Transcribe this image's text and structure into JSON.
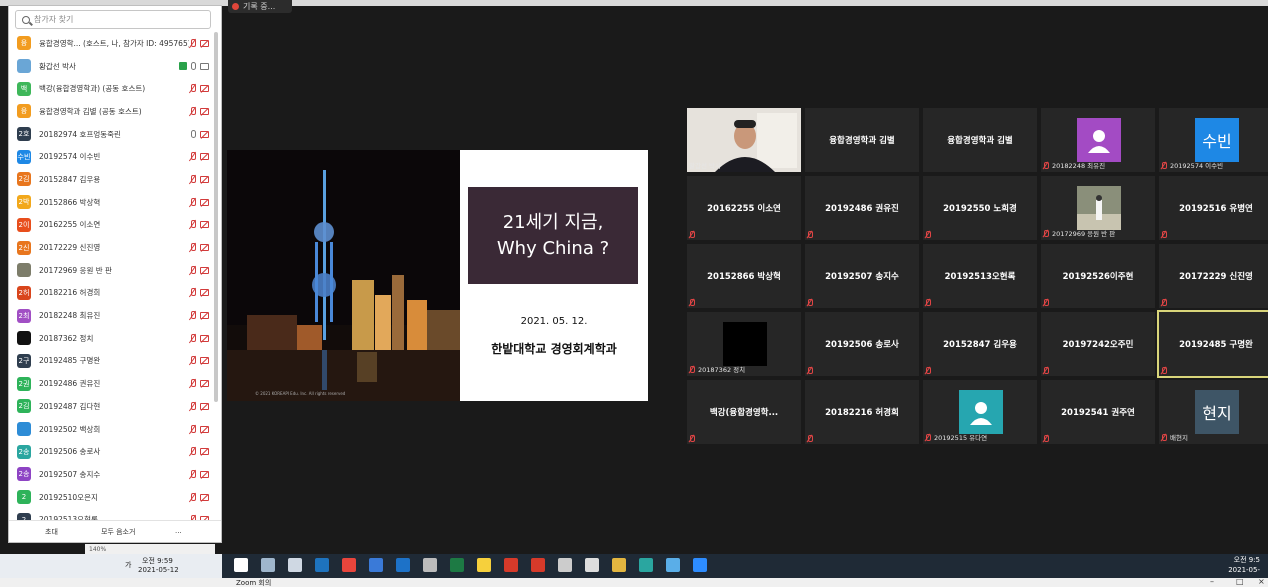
{
  "recording": {
    "label": "기록 중..."
  },
  "participants": {
    "search_placeholder": "참가자 찾기",
    "items": [
      {
        "avatar": "융",
        "color": "#f29c1f",
        "name": "융합경영학...  (호스트, 나, 참가자 ID: 495765)",
        "mic": "muted",
        "cam": "off"
      },
      {
        "avatar": "",
        "color": "#6aa6d6",
        "name": "황갑선 박사",
        "mic": "on",
        "cam": "on",
        "share": true
      },
      {
        "avatar": "백",
        "color": "#3eb75a",
        "name": "백강(융합경영학과) (공동 호스트)",
        "mic": "muted",
        "cam": "off"
      },
      {
        "avatar": "융",
        "color": "#f29c1f",
        "name": "융합경영학과 김별 (공동 호스트)",
        "mic": "muted",
        "cam": "off"
      },
      {
        "avatar": "2호",
        "color": "#2f3e4f",
        "name": "20182974 호프엉동죽린",
        "mic": "on",
        "cam": "off"
      },
      {
        "avatar": "수빈",
        "color": "#1e88e5",
        "name": "20192574 이수빈",
        "mic": "muted",
        "cam": "off"
      },
      {
        "avatar": "2김",
        "color": "#e8761e",
        "name": "20152847 김우용",
        "mic": "muted",
        "cam": "off"
      },
      {
        "avatar": "2박",
        "color": "#f2a81b",
        "name": "20152866 박상혁",
        "mic": "muted",
        "cam": "off"
      },
      {
        "avatar": "2이",
        "color": "#e84e1c",
        "name": "20162255 이소연",
        "mic": "muted",
        "cam": "off"
      },
      {
        "avatar": "2신",
        "color": "#e8761e",
        "name": "20172229 신진영",
        "mic": "muted",
        "cam": "off"
      },
      {
        "avatar": "",
        "color": "#7d7d6a",
        "name": "20172969 응원 반 판",
        "mic": "muted",
        "cam": "off"
      },
      {
        "avatar": "2허",
        "color": "#d9451c",
        "name": "20182216 허경희",
        "mic": "muted",
        "cam": "off"
      },
      {
        "avatar": "2최",
        "color": "#a14fc4",
        "name": "20182248 최유진",
        "mic": "muted",
        "cam": "off"
      },
      {
        "avatar": "",
        "color": "#111111",
        "name": "20187362 정치",
        "mic": "muted",
        "cam": "off"
      },
      {
        "avatar": "2구",
        "color": "#2f3e4f",
        "name": "20192485 구명완",
        "mic": "muted",
        "cam": "off"
      },
      {
        "avatar": "2권",
        "color": "#2eb35a",
        "name": "20192486 권유진",
        "mic": "muted",
        "cam": "off"
      },
      {
        "avatar": "2김",
        "color": "#2eb35a",
        "name": "20192487 김다현",
        "mic": "muted",
        "cam": "off"
      },
      {
        "avatar": "",
        "color": "#2d8cd6",
        "name": "20192502 백상희",
        "mic": "muted",
        "cam": "off"
      },
      {
        "avatar": "2송",
        "color": "#2aa6a0",
        "name": "20192506 송로사",
        "mic": "muted",
        "cam": "off"
      },
      {
        "avatar": "2송",
        "color": "#8e44c4",
        "name": "20192507 송지수",
        "mic": "muted",
        "cam": "off"
      },
      {
        "avatar": "2",
        "color": "#2eb35a",
        "name": "20192510오은지",
        "mic": "muted",
        "cam": "off"
      },
      {
        "avatar": "2",
        "color": "#2f3e4f",
        "name": "20192513오현록",
        "mic": "muted",
        "cam": "off"
      }
    ],
    "footer": {
      "invite": "초대",
      "mute_all": "모두 음소거",
      "more": "..."
    }
  },
  "slide": {
    "title_line1": "21세기 지금,",
    "title_line2": "Why China ?",
    "date": "2021. 05. 12.",
    "dept": "한밭대학교 경영회계학과",
    "copyright": "© 2021 KOREAPI Edu. Inc. All rights reserved"
  },
  "grid": [
    {
      "label": "",
      "sub": "황갑선 박사",
      "muted": false,
      "video": true
    },
    {
      "label": "융합경영학과 김별",
      "sub": "",
      "muted": false
    },
    {
      "label": "융합경영학과 김별",
      "sub": "",
      "muted": false
    },
    {
      "label": "",
      "sub": "20182248 최유진",
      "muted": true,
      "avatar": "person",
      "avatar_color": "#a34bc4"
    },
    {
      "label": "",
      "sub": "20192574 이수빈",
      "muted": true,
      "avatar": "수빈",
      "avatar_color": "#1e88e5"
    },
    {
      "label": "20162255 이소연",
      "sub": "",
      "muted": true
    },
    {
      "label": "20192486 권유진",
      "sub": "",
      "muted": true
    },
    {
      "label": "20192550 노희경",
      "sub": "",
      "muted": true
    },
    {
      "label": "",
      "sub": "20172969 응원 반 판",
      "muted": true,
      "avatar": "photo",
      "avatar_color": "#8a8f7a"
    },
    {
      "label": "20192516 유병연",
      "sub": "",
      "muted": true
    },
    {
      "label": "20152866 박상혁",
      "sub": "",
      "muted": true
    },
    {
      "label": "20192507 송지수",
      "sub": "",
      "muted": true
    },
    {
      "label": "20192513오현록",
      "sub": "",
      "muted": true
    },
    {
      "label": "20192526이주현",
      "sub": "",
      "muted": true
    },
    {
      "label": "20172229 신진영",
      "sub": "",
      "muted": true
    },
    {
      "label": "",
      "sub": "20187362 정치",
      "muted": true,
      "avatar": "black",
      "avatar_color": "#000000"
    },
    {
      "label": "20192506 송로사",
      "sub": "",
      "muted": true
    },
    {
      "label": "20152847 김우용",
      "sub": "",
      "muted": true
    },
    {
      "label": "20197242오주민",
      "sub": "",
      "muted": true
    },
    {
      "label": "20192485 구명완",
      "sub": "",
      "muted": true,
      "active": true
    },
    {
      "label": "백강(융합경영학...",
      "sub": "",
      "muted": true
    },
    {
      "label": "20182216 허경희",
      "sub": "",
      "muted": true
    },
    {
      "label": "",
      "sub": "20192515 유다연",
      "muted": true,
      "avatar": "person",
      "avatar_color": "#26a6b0"
    },
    {
      "label": "20192541 권주연",
      "sub": "",
      "muted": true
    },
    {
      "label": "",
      "sub": "배현지",
      "muted": true,
      "avatar": "현지",
      "avatar_color": "#3e5566"
    }
  ],
  "zoom_control": {
    "value": "140%"
  },
  "taskbar": {
    "tray_left": "오전 9:59",
    "tray_left_date": "2021-05-12",
    "tray_lang": "가",
    "clock_time": "오전 9:5",
    "clock_date": "2021-05-",
    "window_title": "Zoom 회의"
  },
  "colors": {
    "bg": "#1a1a1a",
    "tile": "#262626",
    "active_border": "#d9d57a",
    "muted": "#e04545"
  }
}
